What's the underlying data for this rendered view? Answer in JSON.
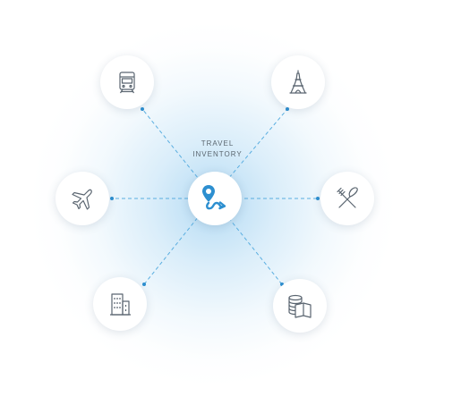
{
  "hub": {
    "label_line1": "TRAVEL",
    "label_line2": "INVENTORY",
    "icon": "route-pin-icon"
  },
  "spokes": [
    {
      "icon": "train-icon"
    },
    {
      "icon": "eiffel-tower-icon"
    },
    {
      "icon": "airplane-icon"
    },
    {
      "icon": "fork-knife-icon"
    },
    {
      "icon": "building-icon"
    },
    {
      "icon": "coins-book-icon"
    }
  ],
  "colors": {
    "accent": "#2d8fd0",
    "line": "#5aaee0",
    "icon_stroke": "#5a6570",
    "label": "#5b6770"
  }
}
